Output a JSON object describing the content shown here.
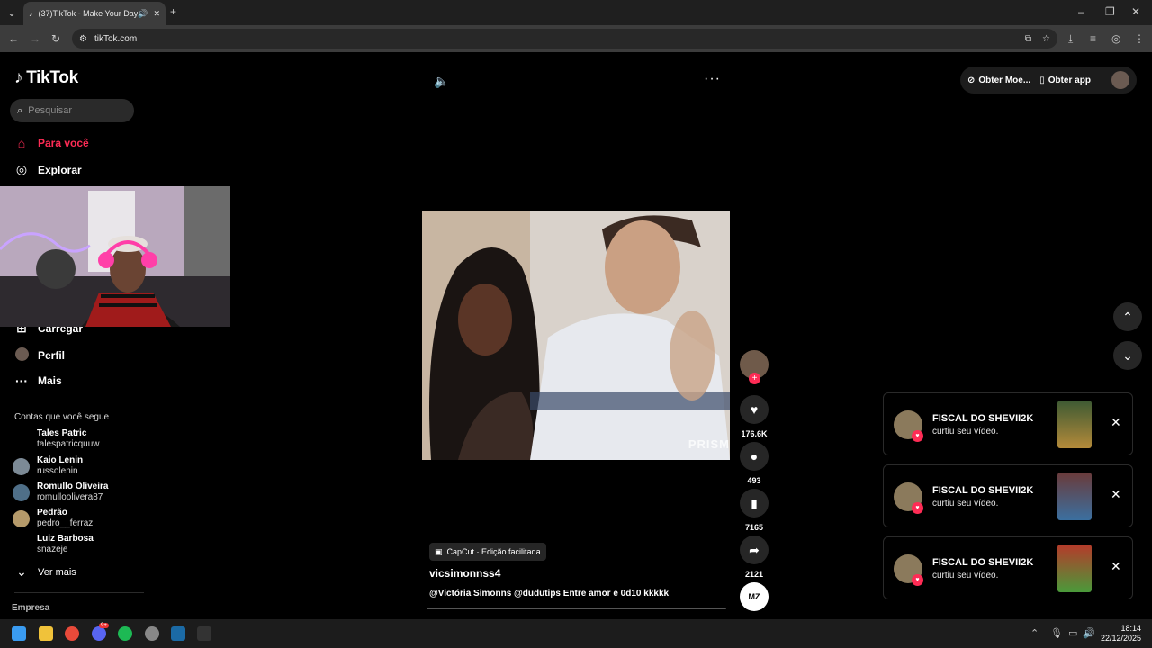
{
  "browser": {
    "tab_title": "(37)TikTok - Make Your Day",
    "url": "tikTok.com"
  },
  "sidebar": {
    "logo": "TikTok",
    "search_placeholder": "Pesquisar",
    "nav": [
      {
        "label": "Para você",
        "icon": "home-icon",
        "active": true
      },
      {
        "label": "Explorar",
        "icon": "compass-icon"
      },
      {
        "label": "Carregar",
        "icon": "upload-icon"
      },
      {
        "label": "Perfil",
        "icon": "profile-icon"
      },
      {
        "label": "Mais",
        "icon": "more-icon"
      }
    ],
    "following_header": "Contas que você segue",
    "accounts": [
      {
        "name": "Tales Patric",
        "handle": "talespatricquuw"
      },
      {
        "name": "Kaio Lenin",
        "handle": "russolenin"
      },
      {
        "name": "Romullo Oliveira",
        "handle": "romulloolivera87"
      },
      {
        "name": "Pedrão",
        "handle": "pedro__ferraz"
      },
      {
        "name": "Luiz Barbosa",
        "handle": "snazeje"
      }
    ],
    "see_more": "Ver mais",
    "footer": "Empresa"
  },
  "header": {
    "coins_label": "Obter Moe...",
    "app_label": "Obter app"
  },
  "video": {
    "watermark": "PRISM",
    "capcut_label": "CapCut · Edição facilitada",
    "author": "vicsimonnss4",
    "description": "@Victória Simonns @dudutips Entre amor e 0d10 kkkkk",
    "progress": 0.0
  },
  "actions": {
    "likes": "176.6K",
    "comments": "493",
    "saves": "7165",
    "shares": "2121"
  },
  "notifications": [
    {
      "name": "FISCAL DO SHEVII2K",
      "text": "curtiu seu vídeo."
    },
    {
      "name": "FISCAL DO SHEVII2K",
      "text": "curtiu seu vídeo."
    },
    {
      "name": "FISCAL DO SHEVII2K",
      "text": "curtiu seu vídeo."
    }
  ],
  "taskbar": {
    "time": "18:14",
    "date": "22/12/2025",
    "discord_badge": "9+"
  },
  "colors": {
    "accent": "#fe2c55",
    "bg": "#000000"
  }
}
